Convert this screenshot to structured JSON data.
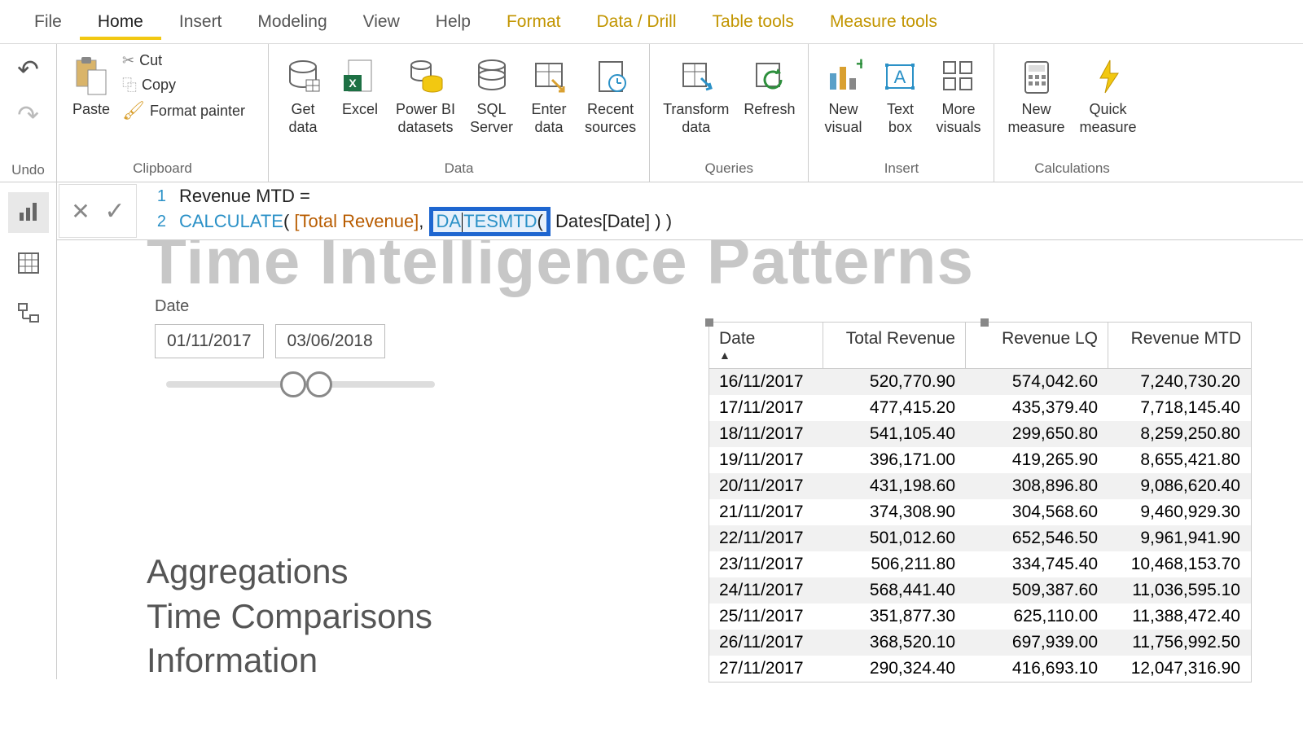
{
  "menu": {
    "items": [
      "File",
      "Home",
      "Insert",
      "Modeling",
      "View",
      "Help",
      "Format",
      "Data / Drill",
      "Table tools",
      "Measure tools"
    ],
    "active": "Home"
  },
  "undo_label": "Undo",
  "ribbon": {
    "clipboard": {
      "label": "Clipboard",
      "paste": "Paste",
      "cut": "Cut",
      "copy": "Copy",
      "format_painter": "Format painter"
    },
    "data": {
      "label": "Data",
      "get_data": "Get\ndata",
      "excel": "Excel",
      "pbi_ds": "Power BI\ndatasets",
      "sql": "SQL\nServer",
      "enter": "Enter\ndata",
      "recent": "Recent\nsources"
    },
    "queries": {
      "label": "Queries",
      "transform": "Transform\ndata",
      "refresh": "Refresh"
    },
    "insert": {
      "label": "Insert",
      "new_visual": "New\nvisual",
      "text_box": "Text\nbox",
      "more": "More\nvisuals"
    },
    "calc": {
      "label": "Calculations",
      "new_measure": "New\nmeasure",
      "quick": "Quick\nmeasure"
    }
  },
  "formula": {
    "line1_name": "Revenue MTD =",
    "calc": "CALCULATE",
    "arg1": "[Total Revenue]",
    "highlighted_left": "DA",
    "highlighted_right": "TESMTD",
    "arg2": "Dates[Date]"
  },
  "bg_title": "Time Intelligence Patterns",
  "slicer": {
    "title": "Date",
    "from": "01/11/2017",
    "to": "03/06/2018"
  },
  "nav": [
    "Aggregations",
    "Time Comparisons",
    "Information"
  ],
  "table": {
    "headers": [
      "Date",
      "Total Revenue",
      "Revenue LQ",
      "Revenue MTD"
    ],
    "rows": [
      [
        "16/11/2017",
        "520,770.90",
        "574,042.60",
        "7,240,730.20"
      ],
      [
        "17/11/2017",
        "477,415.20",
        "435,379.40",
        "7,718,145.40"
      ],
      [
        "18/11/2017",
        "541,105.40",
        "299,650.80",
        "8,259,250.80"
      ],
      [
        "19/11/2017",
        "396,171.00",
        "419,265.90",
        "8,655,421.80"
      ],
      [
        "20/11/2017",
        "431,198.60",
        "308,896.80",
        "9,086,620.40"
      ],
      [
        "21/11/2017",
        "374,308.90",
        "304,568.60",
        "9,460,929.30"
      ],
      [
        "22/11/2017",
        "501,012.60",
        "652,546.50",
        "9,961,941.90"
      ],
      [
        "23/11/2017",
        "506,211.80",
        "334,745.40",
        "10,468,153.70"
      ],
      [
        "24/11/2017",
        "568,441.40",
        "509,387.60",
        "11,036,595.10"
      ],
      [
        "25/11/2017",
        "351,877.30",
        "625,110.00",
        "11,388,472.40"
      ],
      [
        "26/11/2017",
        "368,520.10",
        "697,939.00",
        "11,756,992.50"
      ],
      [
        "27/11/2017",
        "290,324.40",
        "416,693.10",
        "12,047,316.90"
      ]
    ]
  }
}
